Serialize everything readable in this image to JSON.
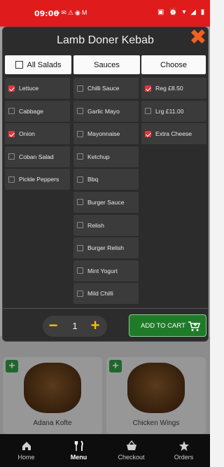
{
  "status_bar": {
    "time": "09:06",
    "app_icons": "●✉⚠◉M",
    "system_icons": "▣ ⏰ ▾ ◢ ▮"
  },
  "modal": {
    "title": "Lamb Doner Kebab",
    "columns": {
      "salads_header": "All Salads",
      "sauces_header": "Sauces",
      "choose_header": "Choose"
    },
    "salads": [
      {
        "label": "Lettuce",
        "checked": true
      },
      {
        "label": "Cabbage",
        "checked": false
      },
      {
        "label": "Onion",
        "checked": true
      },
      {
        "label": "Coban Salad",
        "checked": false
      },
      {
        "label": "Pickle Peppers",
        "checked": false
      }
    ],
    "sauces": [
      {
        "label": "Chilli Sauce",
        "checked": false
      },
      {
        "label": "Garlic Mayo",
        "checked": false
      },
      {
        "label": "Mayonnaise",
        "checked": false
      },
      {
        "label": "Ketchup",
        "checked": false
      },
      {
        "label": "Bbq",
        "checked": false
      },
      {
        "label": "Burger Sauce",
        "checked": false
      },
      {
        "label": "Relish",
        "checked": false
      },
      {
        "label": "Burger Relish",
        "checked": false
      },
      {
        "label": "Mint Yogurt",
        "checked": false
      },
      {
        "label": "Mild Chilli",
        "checked": false
      }
    ],
    "choose": [
      {
        "label": "Reg £8.50",
        "checked": true
      },
      {
        "label": "Lrg £11.00",
        "checked": false
      },
      {
        "label": "Extra Cheese",
        "checked": true
      }
    ],
    "quantity": "1",
    "add_to_cart_label": "ADD TO CART"
  },
  "background_menu": {
    "items": [
      {
        "name": "Adana Kofte"
      },
      {
        "name": "Chicken Wings"
      }
    ]
  },
  "bottom_nav": {
    "items": [
      {
        "label": "Home",
        "icon": "home-icon"
      },
      {
        "label": "Menu",
        "icon": "menu-icon"
      },
      {
        "label": "Checkout",
        "icon": "basket-icon"
      },
      {
        "label": "Orders",
        "icon": "star-icon"
      }
    ],
    "active_index": 1
  },
  "colors": {
    "status_bar": "#e01b1b",
    "modal_bg": "#2c2c2c",
    "option_bg": "#3b3b3b",
    "checkbox_checked": "#d93a3a",
    "close_icon": "#f0621d",
    "qty_accent": "#f2c200",
    "add_cart_bg": "#1f7a2a"
  }
}
